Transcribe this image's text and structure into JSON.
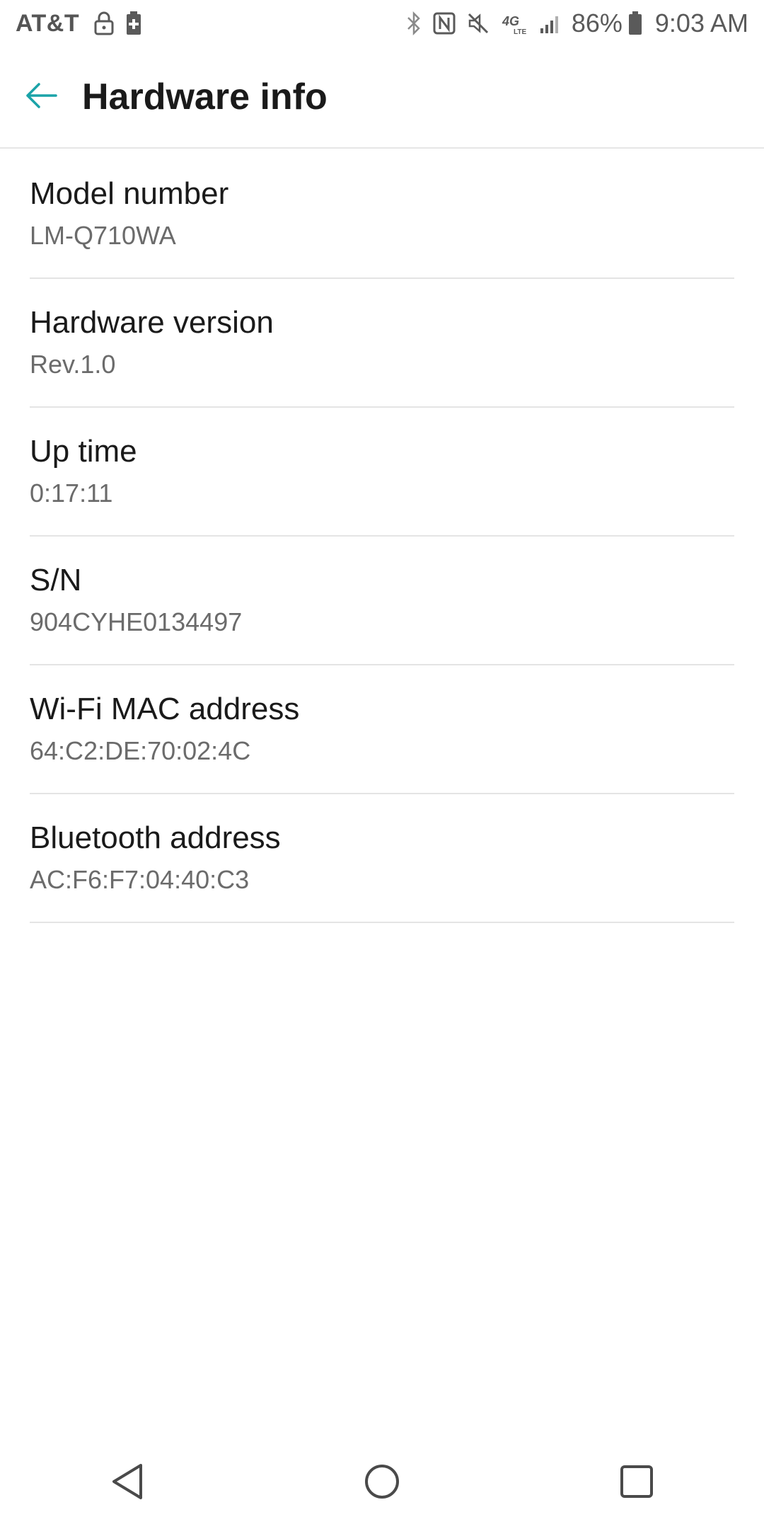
{
  "status_bar": {
    "carrier": "AT&T",
    "battery_percent": "86%",
    "time": "9:03 AM",
    "network": "4G LTE",
    "left_icons": [
      "lock-icon",
      "battery-saver-icon"
    ],
    "right_icons": [
      "bluetooth-icon",
      "nfc-icon",
      "mute-icon",
      "4g-lte-icon",
      "signal-icon",
      "battery-icon"
    ]
  },
  "app_bar": {
    "back_icon": "arrow-left-icon",
    "title": "Hardware info",
    "accent_color": "#1aa3a8"
  },
  "items": [
    {
      "title": "Model number",
      "value": "LM-Q710WA"
    },
    {
      "title": "Hardware version",
      "value": "Rev.1.0"
    },
    {
      "title": "Up time",
      "value": "0:17:11"
    },
    {
      "title": "S/N",
      "value": "904CYHE0134497"
    },
    {
      "title": "Wi-Fi MAC address",
      "value": "64:C2:DE:70:02:4C"
    },
    {
      "title": "Bluetooth address",
      "value": "AC:F6:F7:04:40:C3"
    }
  ],
  "nav_bar": {
    "buttons": [
      "back-triangle-icon",
      "home-circle-icon",
      "recents-square-icon"
    ]
  }
}
